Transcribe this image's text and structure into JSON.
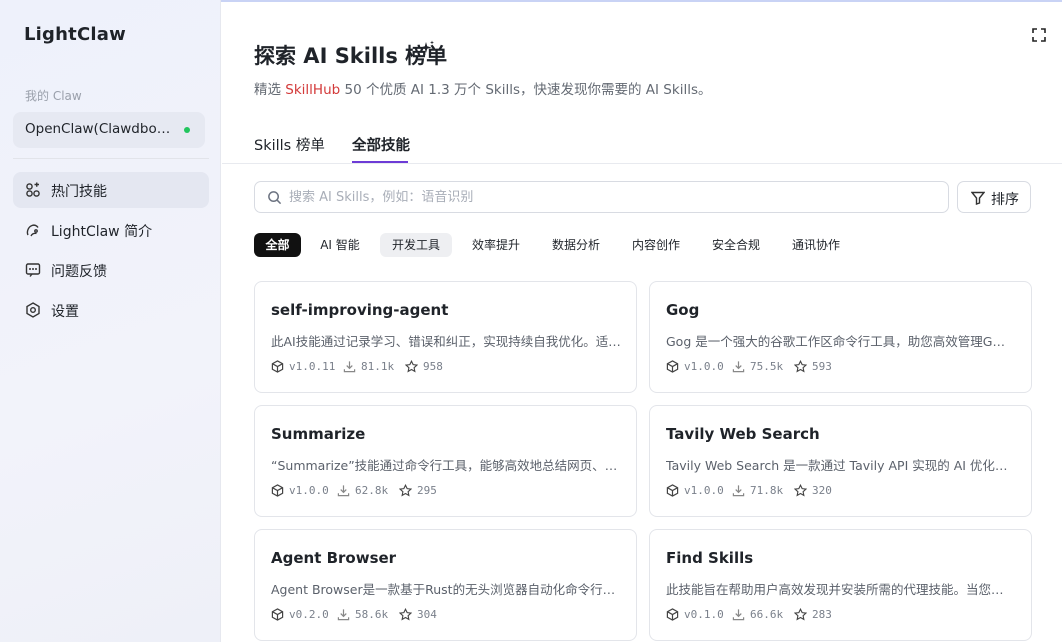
{
  "app": {
    "logo": "LightClaw"
  },
  "sidebar": {
    "section_label": "我的 Claw",
    "claw_name": "OpenClaw(Clawdbot)...",
    "items": [
      {
        "label": "热门技能",
        "icon": "grid-icon",
        "active": true
      },
      {
        "label": "LightClaw 简介",
        "icon": "claw-icon",
        "active": false
      },
      {
        "label": "问题反馈",
        "icon": "feedback-icon",
        "active": false
      },
      {
        "label": "设置",
        "icon": "settings-icon",
        "active": false
      }
    ]
  },
  "header": {
    "title": "探索 AI Skills 榜单",
    "subtitle_prefix": "精选 ",
    "subtitle_highlight": "SkillHub",
    "subtitle_suffix": " 50 个优质 AI 1.3 万个 Skills，快速发现你需要的 AI Skills。"
  },
  "tabs": [
    {
      "label": "Skills 榜单",
      "active": false
    },
    {
      "label": "全部技能",
      "active": true
    }
  ],
  "search": {
    "placeholder": "搜索 AI Skills，例如：语音识别",
    "value": ""
  },
  "sort": {
    "label": "排序"
  },
  "categories": [
    "全部",
    "AI 智能",
    "开发工具",
    "效率提升",
    "数据分析",
    "内容创作",
    "安全合规",
    "通讯协作"
  ],
  "colors": {
    "accent": "#6d3bd6",
    "highlight": "#d33a3a",
    "online": "#22c55e"
  },
  "cards": [
    {
      "name": "self-improving-agent",
      "desc": "此AI技能通过记录学习、错误和纠正，实现持续自我优化。适用于需要不断改进的场景",
      "version": "v1.0.11",
      "downloads": "81.1k",
      "stars": "958"
    },
    {
      "name": "Gog",
      "desc": "Gog 是一个强大的谷歌工作区命令行工具，助您高效管理Gmail、日历等服务",
      "version": "v1.0.0",
      "downloads": "75.5k",
      "stars": "593"
    },
    {
      "name": "Summarize",
      "desc": "“Summarize”技能通过命令行工具，能够高效地总结网页、PDF和视频等内容",
      "version": "v1.0.0",
      "downloads": "62.8k",
      "stars": "295"
    },
    {
      "name": "Tavily Web Search",
      "desc": "Tavily Web Search 是一款通过 Tavily API 实现的 AI 优化网络搜索工具",
      "version": "v1.0.0",
      "downloads": "71.8k",
      "stars": "320"
    },
    {
      "name": "Agent Browser",
      "desc": "Agent Browser是一款基于Rust的无头浏览器自动化命令行工具，支持多种操作",
      "version": "v0.2.0",
      "downloads": "58.6k",
      "stars": "304"
    },
    {
      "name": "Find Skills",
      "desc": "此技能旨在帮助用户高效发现并安装所需的代理技能。当您需要扩展能力时使用",
      "version": "v0.1.0",
      "downloads": "66.6k",
      "stars": "283"
    }
  ]
}
